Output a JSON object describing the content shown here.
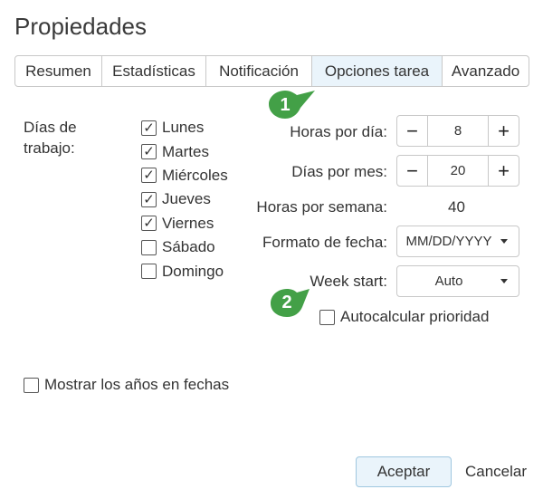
{
  "dialog": {
    "title": "Propiedades"
  },
  "tabs": [
    {
      "label": "Resumen",
      "active": false
    },
    {
      "label": "Estadísticas",
      "active": false
    },
    {
      "label": "Notificación",
      "active": false
    },
    {
      "label": "Opciones tarea",
      "active": true
    },
    {
      "label": "Avanzado",
      "active": false
    }
  ],
  "callouts": [
    {
      "number": "1",
      "color": "#43a047"
    },
    {
      "number": "2",
      "color": "#43a047"
    }
  ],
  "work_days": {
    "label_line1": "Días de",
    "label_line2": "trabajo:",
    "days": [
      {
        "label": "Lunes",
        "checked": true
      },
      {
        "label": "Martes",
        "checked": true
      },
      {
        "label": "Miércoles",
        "checked": true
      },
      {
        "label": "Jueves",
        "checked": true
      },
      {
        "label": "Viernes",
        "checked": true
      },
      {
        "label": "Sábado",
        "checked": false
      },
      {
        "label": "Domingo",
        "checked": false
      }
    ]
  },
  "settings": {
    "hours_per_day": {
      "label": "Horas por día:",
      "value": "8",
      "minus": "−",
      "plus": "+"
    },
    "days_per_month": {
      "label": "Días por mes:",
      "value": "20",
      "minus": "−",
      "plus": "+"
    },
    "hours_per_week": {
      "label": "Horas por semana:",
      "value": "40"
    },
    "date_format": {
      "label": "Formato de fecha:",
      "value": "MM/DD/YYYY"
    },
    "week_start": {
      "label": "Week start:",
      "value": "Auto"
    },
    "auto_priority": {
      "label": "Autocalcular prioridad",
      "checked": false
    }
  },
  "show_years": {
    "label": "Mostrar los años en fechas",
    "checked": false
  },
  "buttons": {
    "accept": "Aceptar",
    "cancel": "Cancelar"
  },
  "checkmark": "✓"
}
